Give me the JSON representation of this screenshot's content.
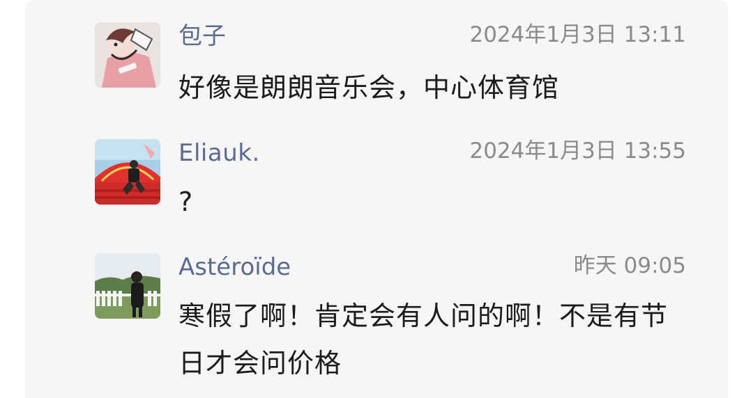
{
  "comments": [
    {
      "author": "包子",
      "time": "2024年1月3日 13:11",
      "text": "好像是朗朗音乐会，中心体育馆",
      "avatar_icon": "cartoon-person-avatar"
    },
    {
      "author": "Eliauk.",
      "time": "2024年1月3日 13:55",
      "text": "?",
      "avatar_icon": "person-sitting-red-stage-avatar"
    },
    {
      "author": "Astéroïde",
      "time": "昨天 09:05",
      "text": "寒假了啊！肯定会有人问的啊！不是有节日才会问价格",
      "avatar_icon": "woman-by-fence-avatar"
    }
  ],
  "colors": {
    "author_name": "#5a6b8f",
    "timestamp": "#8a8a8a",
    "comment_text": "#1b1b1b",
    "panel_background": "#f6f6f6"
  }
}
